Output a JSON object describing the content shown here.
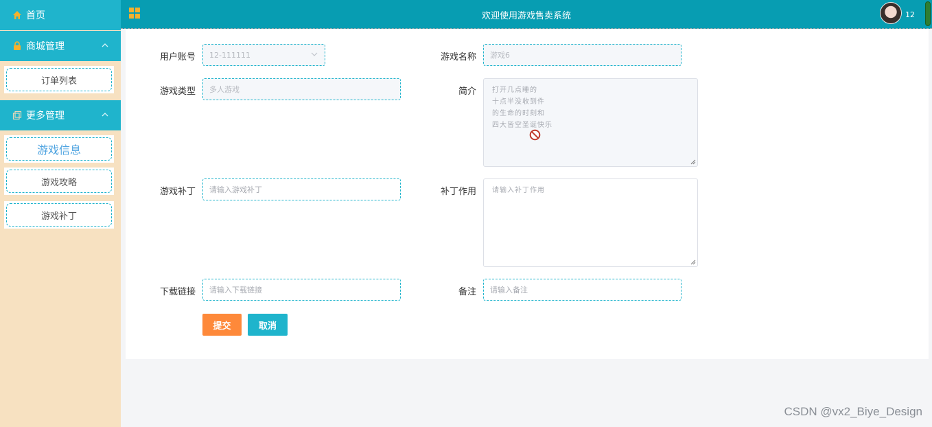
{
  "app": {
    "title": "欢迎使用游戏售卖系统",
    "user_num": "12"
  },
  "sidebar": {
    "home": "首页",
    "mall_group": "商城管理",
    "order_list": "订单列表",
    "more_group": "更多管理",
    "items": [
      "游戏信息",
      "游戏攻略",
      "游戏补丁"
    ]
  },
  "form": {
    "user_account": {
      "label": "用户账号",
      "value": "12-111111"
    },
    "game_name": {
      "label": "游戏名称",
      "value": "游戏6"
    },
    "game_type": {
      "label": "游戏类型",
      "value": "多人游戏"
    },
    "intro": {
      "label": "简介",
      "lines": [
        "打开几点睡的",
        "十点半没收到件",
        "的生命的时刻和",
        "四大皆空圣诞快乐"
      ]
    },
    "patch": {
      "label": "游戏补丁",
      "placeholder": "请输入游戏补丁"
    },
    "patch_effect": {
      "label": "补丁作用",
      "placeholder": "请输入补丁作用"
    },
    "download": {
      "label": "下载链接",
      "placeholder": "请输入下载链接"
    },
    "remark": {
      "label": "备注",
      "placeholder": "请输入备注"
    },
    "submit": "提交",
    "cancel": "取消"
  },
  "watermark": "CSDN @vx2_Biye_Design",
  "colors": {
    "header": "#079db2",
    "sidebar_head": "#1fb4cc",
    "sidebar_bg": "#f7e1c1",
    "submit": "#fe893a",
    "cancel": "#1fb4cc"
  }
}
